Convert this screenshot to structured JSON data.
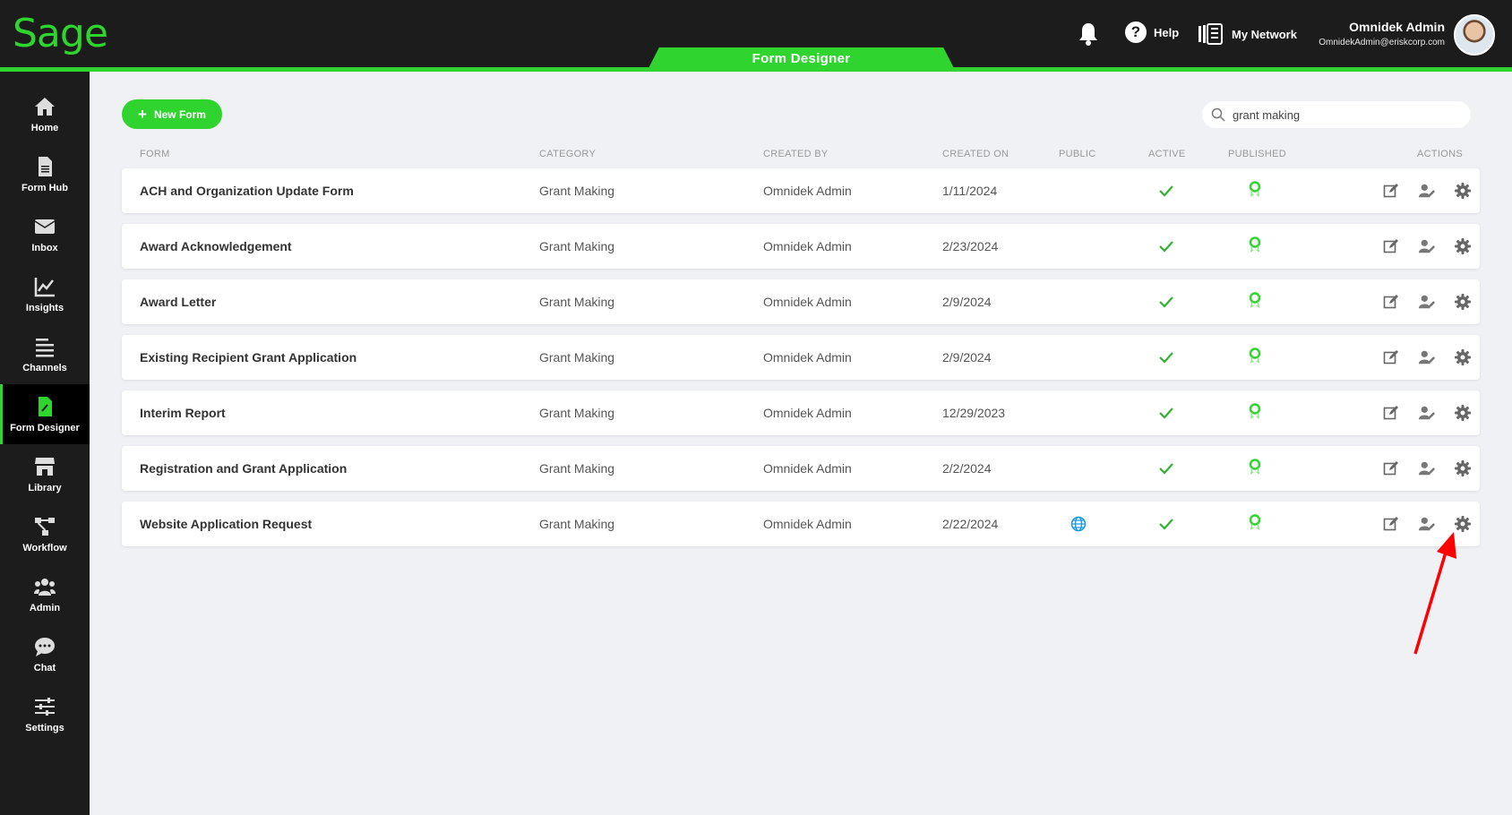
{
  "brand": {
    "logo_text": "Sage",
    "accent": "#2fd42f"
  },
  "header": {
    "active_tab": "Form Designer",
    "help_label": "Help",
    "network_label": "My Network",
    "user_name": "Omnidek Admin",
    "user_email": "OmnidekAdmin@eriskcorp.com"
  },
  "sidebar": {
    "items": [
      {
        "label": "Home",
        "icon": "home-icon"
      },
      {
        "label": "Form Hub",
        "icon": "document-icon"
      },
      {
        "label": "Inbox",
        "icon": "envelope-icon"
      },
      {
        "label": "Insights",
        "icon": "chart-icon"
      },
      {
        "label": "Channels",
        "icon": "lines-icon"
      },
      {
        "label": "Form Designer",
        "icon": "form-edit-icon",
        "active": true
      },
      {
        "label": "Library",
        "icon": "store-icon"
      },
      {
        "label": "Workflow",
        "icon": "workflow-icon"
      },
      {
        "label": "Admin",
        "icon": "users-icon"
      },
      {
        "label": "Chat",
        "icon": "chat-icon"
      },
      {
        "label": "Settings",
        "icon": "sliders-icon"
      }
    ]
  },
  "toolbar": {
    "new_form_label": "New Form",
    "search_value": "grant making"
  },
  "table": {
    "columns": [
      "FORM",
      "CATEGORY",
      "CREATED BY",
      "CREATED ON",
      "PUBLIC",
      "ACTIVE",
      "PUBLISHED",
      "ACTIONS"
    ],
    "rows": [
      {
        "form": "ACH and Organization Update Form",
        "category": "Grant Making",
        "created_by": "Omnidek Admin",
        "created_on": "1/11/2024",
        "public": false,
        "active": true,
        "published": true
      },
      {
        "form": "Award Acknowledgement",
        "category": "Grant Making",
        "created_by": "Omnidek Admin",
        "created_on": "2/23/2024",
        "public": false,
        "active": true,
        "published": true
      },
      {
        "form": "Award Letter",
        "category": "Grant Making",
        "created_by": "Omnidek Admin",
        "created_on": "2/9/2024",
        "public": false,
        "active": true,
        "published": true
      },
      {
        "form": "Existing Recipient Grant Application",
        "category": "Grant Making",
        "created_by": "Omnidek Admin",
        "created_on": "2/9/2024",
        "public": false,
        "active": true,
        "published": true
      },
      {
        "form": "Interim Report",
        "category": "Grant Making",
        "created_by": "Omnidek Admin",
        "created_on": "12/29/2023",
        "public": false,
        "active": true,
        "published": true
      },
      {
        "form": "Registration and Grant Application",
        "category": "Grant Making",
        "created_by": "Omnidek Admin",
        "created_on": "2/2/2024",
        "public": false,
        "active": true,
        "published": true
      },
      {
        "form": "Website Application Request",
        "category": "Grant Making",
        "created_by": "Omnidek Admin",
        "created_on": "2/22/2024",
        "public": true,
        "active": true,
        "published": true
      }
    ]
  },
  "annotation": {
    "arrow_color": "#ff0000"
  }
}
